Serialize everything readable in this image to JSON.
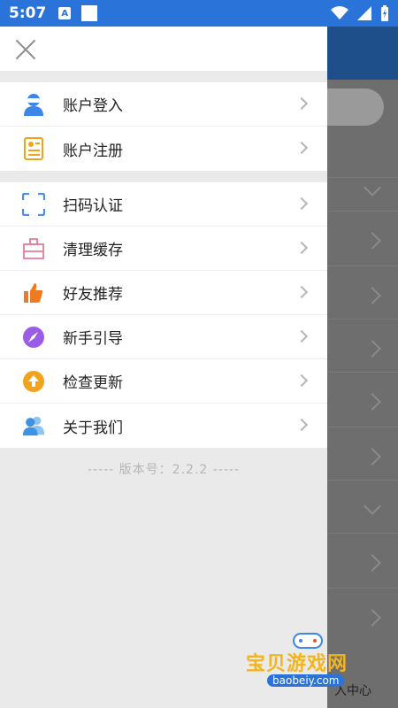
{
  "status_bar": {
    "time": "5:07",
    "app_badge": "A"
  },
  "drawer": {
    "group1": [
      {
        "label": "账户登入",
        "icon": "user-icon"
      },
      {
        "label": "账户注册",
        "icon": "register-card-icon"
      }
    ],
    "group2": [
      {
        "label": "扫码认证",
        "icon": "scan-icon"
      },
      {
        "label": "清理缓存",
        "icon": "clear-cache-icon"
      },
      {
        "label": "好友推荐",
        "icon": "thumbs-up-icon"
      },
      {
        "label": "新手引导",
        "icon": "compass-icon"
      },
      {
        "label": "检查更新",
        "icon": "update-arrow-icon"
      },
      {
        "label": "关于我们",
        "icon": "about-us-users-icon"
      }
    ],
    "version_text": "----- 版本号：2.2.2 -----"
  },
  "background": {
    "bottom_label": "入中心"
  },
  "watermark": {
    "title": "宝贝游戏网",
    "url": "baobeiy.com"
  },
  "colors": {
    "status_bar": "#2a73d9",
    "user_icon": "#3b86e6",
    "register_icon": "#f2a31b",
    "scan_icon": "#4a8fe6",
    "cache_icon": "#e97c95",
    "thumb_icon": "#f07a1f",
    "compass_icon": "#9a5de6",
    "update_icon": "#f2a31b",
    "about_icon": "#59a7e8"
  }
}
